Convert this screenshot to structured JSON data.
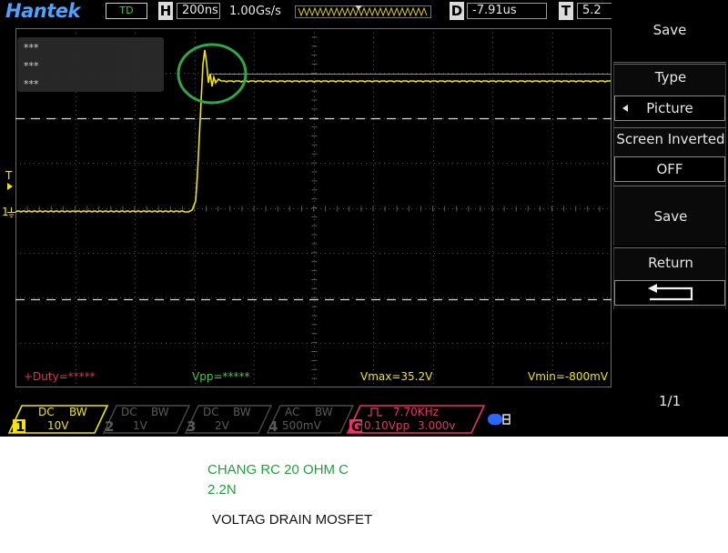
{
  "scope": {
    "brand": "Hantek",
    "mode_badge": "TD",
    "timebase_key": "H",
    "timebase": "200ns",
    "sample_rate": "1.00Gs/s",
    "delay_key": "D",
    "delay": "-7.91us",
    "trigger_key": "T",
    "trigger_level": "5.2",
    "readout_lines": [
      "***",
      "***",
      "***"
    ],
    "trigger_marker": "T",
    "ch1_marker": "1",
    "measurements": {
      "duty": "+Duty=*****",
      "vpp": "Vpp=*****",
      "vmax": "Vmax=35.2V",
      "vmin": "Vmin=-800mV"
    },
    "waveform_color": "#f2e600",
    "highlight_color": "#2ea84a"
  },
  "channels": [
    {
      "num": "1",
      "coupling": "DC",
      "bw": "BW",
      "scale": "10V",
      "color": "#f2e600",
      "active": true
    },
    {
      "num": "2",
      "coupling": "DC",
      "bw": "BW",
      "scale": "1V",
      "color": "#5a5a5a",
      "active": false
    },
    {
      "num": "3",
      "coupling": "DC",
      "bw": "BW",
      "scale": "2V",
      "color": "#5a5a5a",
      "active": false
    },
    {
      "num": "4",
      "coupling": "AC",
      "bw": "BW",
      "scale": "500mV",
      "color": "#5a5a5a",
      "active": false
    }
  ],
  "generator": {
    "label": "G",
    "frequency": "7.70KHz",
    "amplitude": "0.10Vpp",
    "offset": "3.000v",
    "color": "#e8336b"
  },
  "menu": {
    "title": "Save",
    "type_label": "Type",
    "type_value": "Picture",
    "screen_inverted_label": "Screen Inverted",
    "screen_inverted_value": "OFF",
    "save_label": "Save",
    "return_label": "Return",
    "page": "1/1"
  },
  "notes": {
    "line1": "CHANG RC 20 OHM C",
    "line2": "2.2N",
    "line3": "VOLTAG DRAIN MOSFET"
  }
}
